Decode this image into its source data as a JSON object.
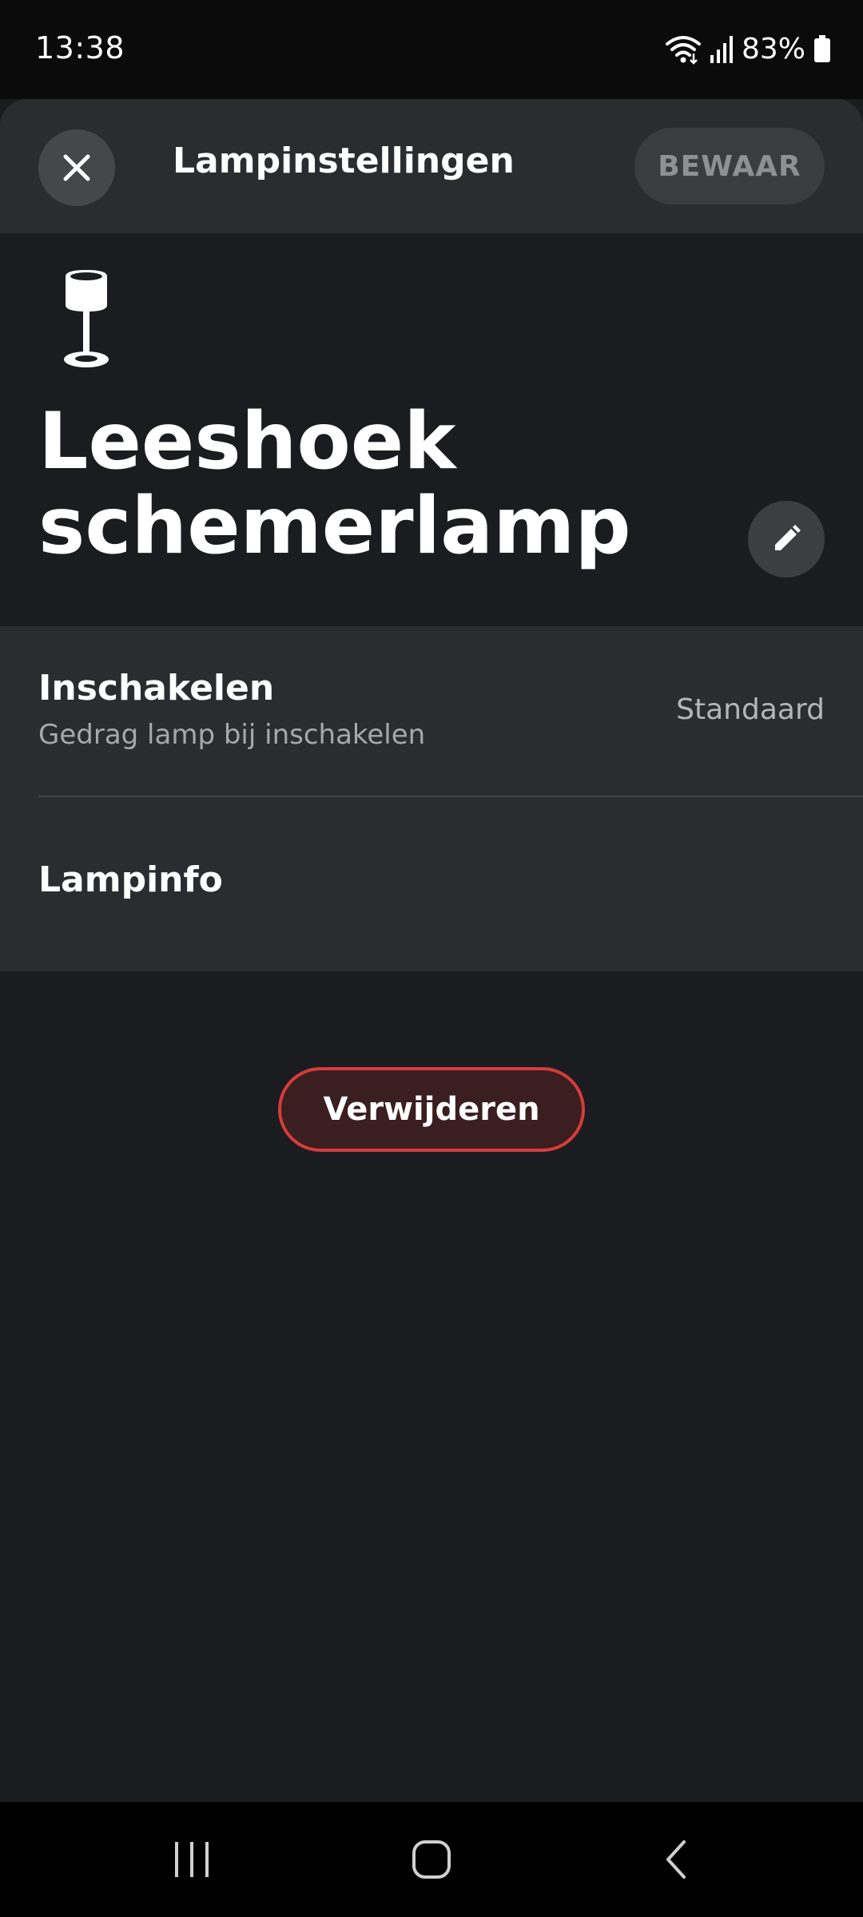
{
  "status_bar": {
    "time": "13:38",
    "battery": "83%",
    "icons": [
      "wifi-icon",
      "signal-icon",
      "battery-icon"
    ]
  },
  "header": {
    "close_icon": "close-icon",
    "title": "Lampinstellingen",
    "save_label": "BEWAAR"
  },
  "lamp": {
    "icon": "table-lamp-icon",
    "name": "Leeshoek schemerlamp",
    "edit_icon": "pencil-icon"
  },
  "settings": {
    "power_on": {
      "title": "Inschakelen",
      "subtitle": "Gedrag lamp bij inschakelen",
      "value": "Standaard"
    },
    "lamp_info": {
      "title": "Lampinfo"
    }
  },
  "delete_label": "Verwijderen",
  "nav_bar": {
    "items": [
      "recent-apps-icon",
      "home-icon",
      "back-icon"
    ]
  },
  "colors": {
    "background": "#1a1c20",
    "card": "#2a2c30",
    "delete_border": "#d63b3b",
    "delete_fill": "#3a1e20"
  }
}
